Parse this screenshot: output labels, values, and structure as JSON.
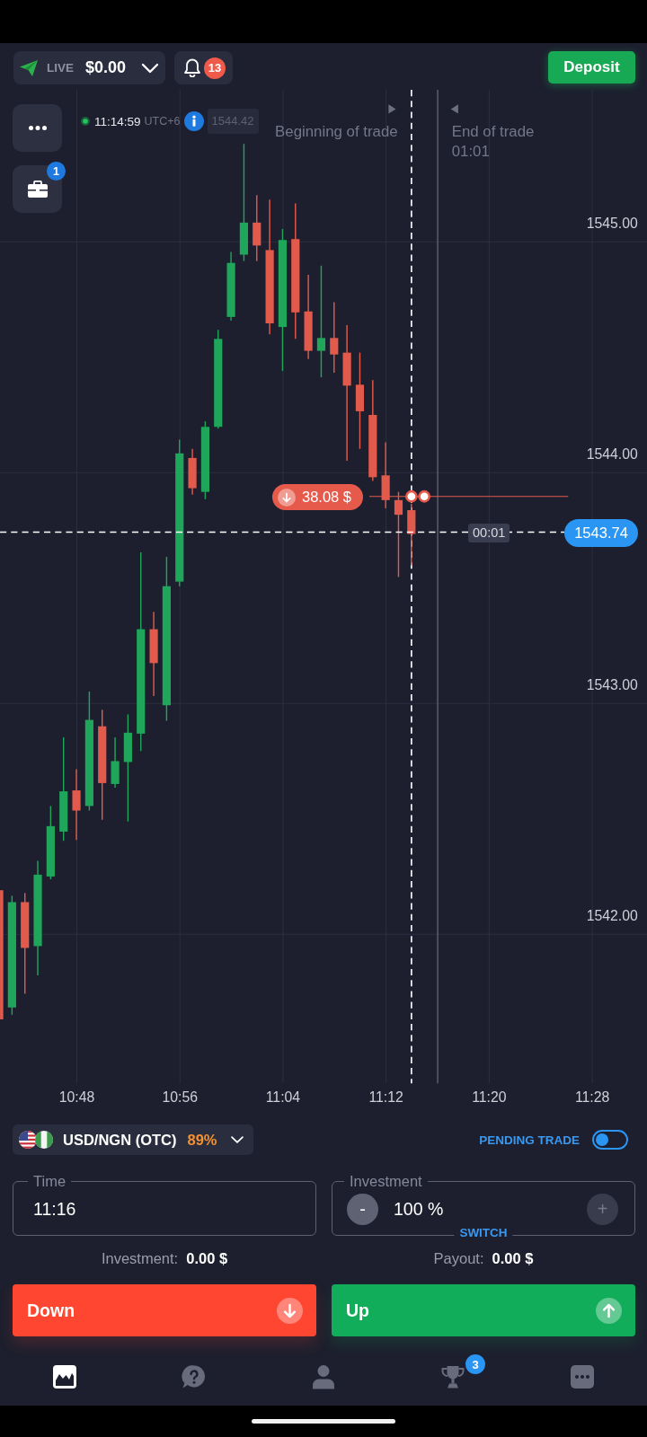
{
  "top_bar": {
    "account": {
      "mode": "LIVE",
      "balance": "$0.00"
    },
    "notifications": {
      "count": "13"
    },
    "deposit_button": "Deposit"
  },
  "chart": {
    "portfolio_badge": "1",
    "clock": {
      "time": "11:14:59",
      "timezone": "UTC+6"
    },
    "price_tag": "1544.42",
    "beginning_label": "Beginning of trade",
    "end_label": "End of trade",
    "end_timer": "01:01",
    "price_labels": [
      "1545.00",
      "1544.00",
      "1543.00",
      "1542.00"
    ],
    "time_labels": [
      "10:48",
      "10:56",
      "11:04",
      "11:12",
      "11:20",
      "11:28"
    ],
    "current_price": "1543.74",
    "countdown": "00:01",
    "open_trade": {
      "kind": "down",
      "amount": "38.08 $"
    }
  },
  "asset_selector": {
    "name": "USD/NGN (OTC)",
    "payout": "89%"
  },
  "pending_trade": {
    "label": "PENDING TRADE",
    "on": false
  },
  "time_field": {
    "label": "Time",
    "value": "11:16"
  },
  "investment_field": {
    "label": "Investment",
    "value": "100 %",
    "decrease": {
      "symbol": "-",
      "disabled": false
    },
    "increase": {
      "symbol": "+",
      "disabled": true
    },
    "switch_label": "SWITCH"
  },
  "summary": [
    {
      "label": "Investment:",
      "value": "0.00 $"
    },
    {
      "label": "Payout:",
      "value": "0.00 $"
    }
  ],
  "trade_buttons": [
    {
      "kind": "down",
      "label": "Down"
    },
    {
      "kind": "up",
      "label": "Up"
    }
  ],
  "bottom_nav": [
    {
      "kind": "chart",
      "selected": true
    },
    {
      "kind": "help",
      "selected": false
    },
    {
      "kind": "profile",
      "selected": false
    },
    {
      "kind": "trophy",
      "selected": false,
      "badge": "3"
    },
    {
      "kind": "more",
      "selected": false
    }
  ]
}
